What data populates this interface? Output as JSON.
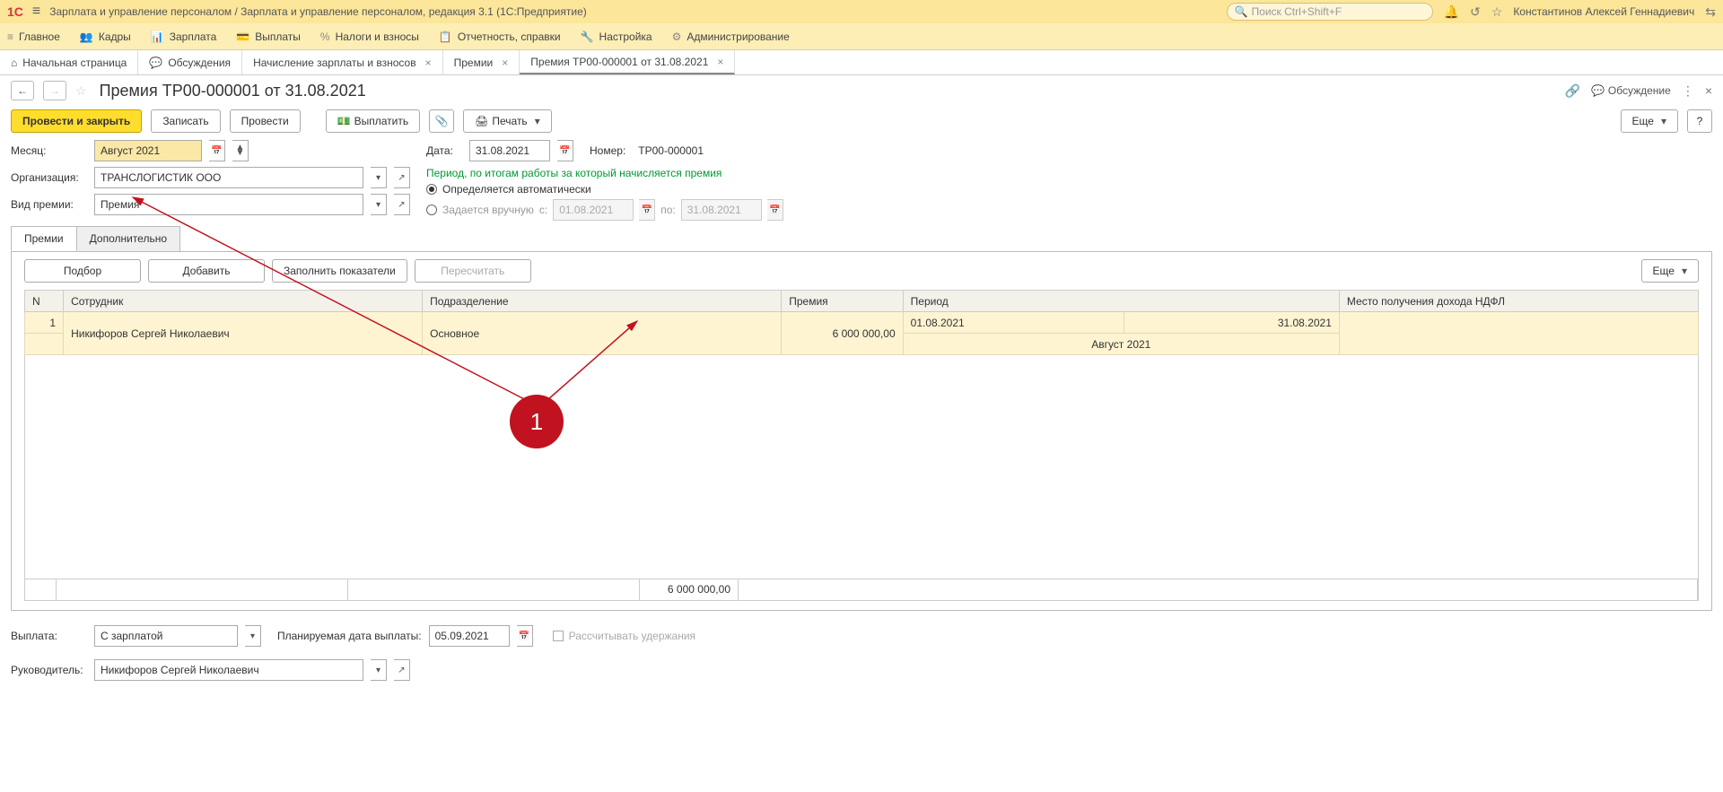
{
  "titlebar": {
    "title": "Зарплата и управление персоналом / Зарплата и управление персоналом, редакция 3.1  (1С:Предприятие)",
    "search_placeholder": "Поиск Ctrl+Shift+F",
    "username": "Константинов Алексей Геннадиевич"
  },
  "mainmenu": [
    {
      "icon": "≡",
      "label": "Главное"
    },
    {
      "icon": "👥",
      "label": "Кадры"
    },
    {
      "icon": "📊",
      "label": "Зарплата"
    },
    {
      "icon": "💳",
      "label": "Выплаты"
    },
    {
      "icon": "%",
      "label": "Налоги и взносы"
    },
    {
      "icon": "📋",
      "label": "Отчетность, справки"
    },
    {
      "icon": "🔧",
      "label": "Настройка"
    },
    {
      "icon": "⚙",
      "label": "Администрирование"
    }
  ],
  "tabs": [
    {
      "icon": "⌂",
      "label": "Начальная страница",
      "closable": false
    },
    {
      "icon": "💬",
      "label": "Обсуждения",
      "closable": false
    },
    {
      "icon": "",
      "label": "Начисление зарплаты и взносов",
      "closable": true
    },
    {
      "icon": "",
      "label": "Премии",
      "closable": true
    },
    {
      "icon": "",
      "label": "Премия ТР00-000001 от 31.08.2021",
      "closable": true,
      "active": true
    }
  ],
  "page": {
    "title": "Премия ТР00-000001 от 31.08.2021",
    "discuss": "Обсуждение"
  },
  "toolbar": {
    "post_close": "Провести и закрыть",
    "save": "Записать",
    "post": "Провести",
    "pay": "Выплатить",
    "print": "Печать",
    "more": "Еще",
    "help": "?"
  },
  "form": {
    "month_label": "Месяц:",
    "month_value": "Август 2021",
    "org_label": "Организация:",
    "org_value": "ТРАНСЛОГИСТИК ООО",
    "bonus_type_label": "Вид премии:",
    "bonus_type_value": "Премия",
    "date_label": "Дата:",
    "date_value": "31.08.2021",
    "number_label": "Номер:",
    "number_value": "ТР00-000001",
    "period_title": "Период, по итогам работы за который начисляется премия",
    "period_auto": "Определяется автоматически",
    "period_manual": "Задается вручную",
    "period_from_label": "с:",
    "period_from": "01.08.2021",
    "period_to_label": "по:",
    "period_to": "31.08.2021"
  },
  "subtabs": {
    "t1": "Премии",
    "t2": "Дополнительно"
  },
  "tab_toolbar": {
    "pick": "Подбор",
    "add": "Добавить",
    "fill": "Заполнить показатели",
    "recalc": "Пересчитать",
    "more": "Еще"
  },
  "grid": {
    "col_n": "N",
    "col_emp": "Сотрудник",
    "col_dept": "Подразделение",
    "col_bonus": "Премия",
    "col_period": "Период",
    "col_ndfl": "Место получения дохода НДФЛ",
    "row1": {
      "n": "1",
      "emp": "Никифоров Сергей Николаевич",
      "dept": "Основное",
      "bonus": "6 000 000,00",
      "period_from": "01.08.2021",
      "period_to": "31.08.2021",
      "period_month": "Август 2021"
    },
    "total_bonus": "6 000 000,00"
  },
  "bottom": {
    "payout_label": "Выплата:",
    "payout_value": "С зарплатой",
    "planned_date_label": "Планируемая дата выплаты:",
    "planned_date_value": "05.09.2021",
    "calc_deduct": "Рассчитывать удержания",
    "manager_label": "Руководитель:",
    "manager_value": "Никифоров Сергей Николаевич"
  },
  "annotation": {
    "num": "1"
  }
}
